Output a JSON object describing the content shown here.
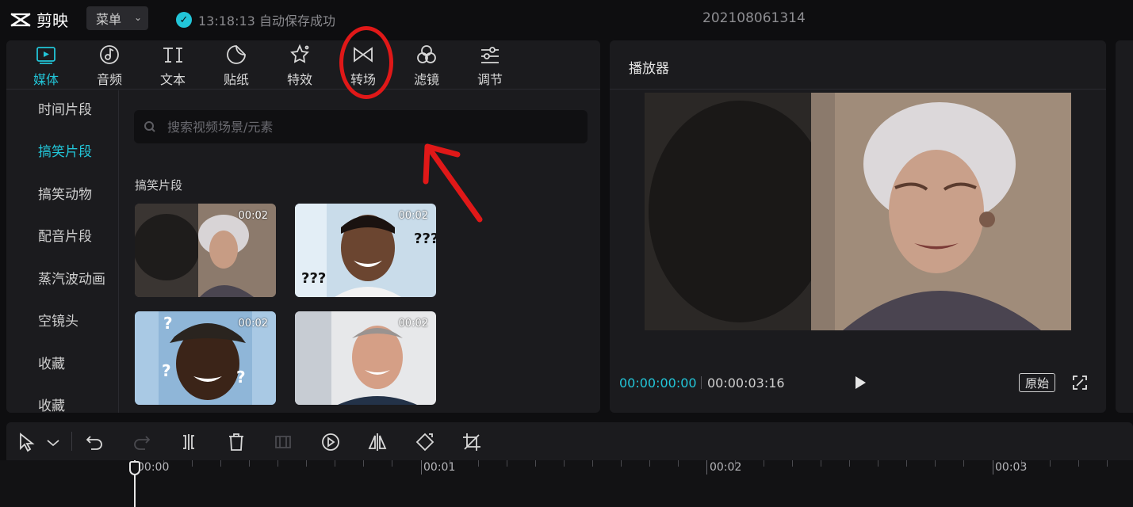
{
  "app": {
    "name": "剪映",
    "menu_label": "菜单",
    "save_status": "13:18:13 自动保存成功",
    "project_title": "202108061314"
  },
  "tool_tabs": [
    {
      "label": "媒体",
      "icon": "media-icon",
      "active": true
    },
    {
      "label": "音频",
      "icon": "audio-icon",
      "active": false
    },
    {
      "label": "文本",
      "icon": "text-icon",
      "active": false
    },
    {
      "label": "贴纸",
      "icon": "sticker-icon",
      "active": false
    },
    {
      "label": "特效",
      "icon": "effects-icon",
      "active": false
    },
    {
      "label": "转场",
      "icon": "transition-icon",
      "active": false
    },
    {
      "label": "滤镜",
      "icon": "filter-icon",
      "active": false
    },
    {
      "label": "调节",
      "icon": "adjust-icon",
      "active": false
    }
  ],
  "categories": [
    {
      "label": "时间片段",
      "active": false
    },
    {
      "label": "搞笑片段",
      "active": true
    },
    {
      "label": "搞笑动物",
      "active": false
    },
    {
      "label": "配音片段",
      "active": false
    },
    {
      "label": "蒸汽波动画",
      "active": false
    },
    {
      "label": "空镜头",
      "active": false
    },
    {
      "label": "收藏",
      "active": false
    },
    {
      "label": "收藏",
      "active": false
    }
  ],
  "search": {
    "placeholder": "搜索视频场景/元素",
    "value": ""
  },
  "section_title": "搞笑片段",
  "thumbnails": [
    {
      "duration": "00:02",
      "caption": ""
    },
    {
      "duration": "00:02",
      "caption": "???"
    },
    {
      "duration": "00:02",
      "caption": "?"
    },
    {
      "duration": "00:02",
      "caption": ""
    }
  ],
  "player": {
    "title": "播放器",
    "current_time": "00:00:00:00",
    "total_time": "00:00:03:16",
    "original_label": "原始"
  },
  "timeline": {
    "ticks": [
      "00:00",
      "00:01",
      "00:02",
      "00:03"
    ]
  },
  "colors": {
    "accent": "#22c5d8",
    "annotation": "#e01818",
    "background": "#0e0e10",
    "panel": "#1b1b1e"
  }
}
